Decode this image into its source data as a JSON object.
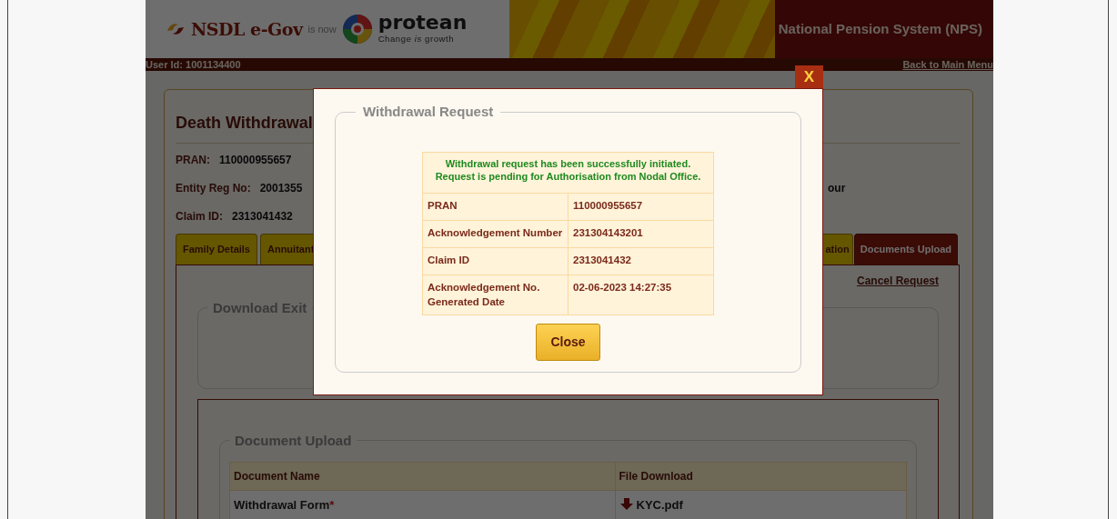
{
  "header": {
    "brand": "NSDL e-Gov",
    "brand_note": "is now",
    "brand2": "protean",
    "tagline": "Change *is* growth",
    "system_title": "National Pension System (NPS)"
  },
  "user_bar": {
    "user_id": "User Id: 1001134400",
    "back_link": "Back to Main Menu"
  },
  "page": {
    "title": "Death Withdrawal",
    "fields": [
      {
        "label": "PRAN:",
        "value": "110000955657"
      },
      {
        "label": "Entity Reg No:",
        "value": "2001355"
      },
      {
        "label": "Claim ID:",
        "value": "2313041432"
      }
    ],
    "side_text": "our",
    "tabs": [
      {
        "label": "Family Details",
        "selected": false
      },
      {
        "label": "Annuitant",
        "selected": false
      },
      {
        "label": "ation",
        "selected": false
      },
      {
        "label": "Documents Upload",
        "selected": true
      }
    ],
    "cancel_link": "Cancel Request",
    "download_section": {
      "legend": "Download Exit"
    },
    "upload_section": {
      "legend": "Document Upload",
      "columns": [
        "Document Name",
        "File Download"
      ],
      "rows": [
        {
          "name": "Withdrawal Form",
          "required_mark": "*",
          "file": "KYC.pdf"
        }
      ]
    }
  },
  "modal": {
    "close_x": "X",
    "title": "Withdrawal Request",
    "message_lines": [
      "Withdrawal request has been successfully initiated.",
      "Request is pending for Authorisation from Nodal Office."
    ],
    "rows": [
      {
        "label": "PRAN",
        "value": "110000955657"
      },
      {
        "label": "Acknowledgement Number",
        "value": "231304143201"
      },
      {
        "label": "Claim ID",
        "value": "2313041432"
      },
      {
        "label": "Acknowledgement No. Generated Date",
        "value": "02-06-2023 14:27:35"
      }
    ],
    "close_button": "Close"
  }
}
